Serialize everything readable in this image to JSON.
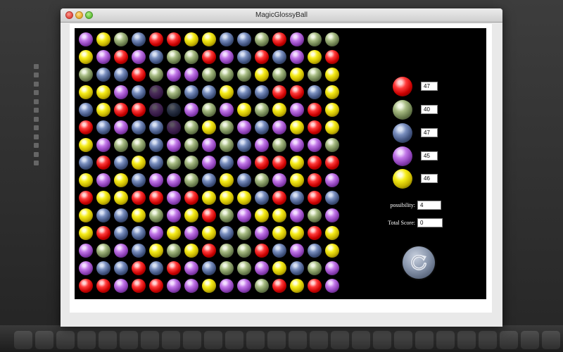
{
  "window": {
    "title": "MagicGlossyBall"
  },
  "board": {
    "rows": [
      [
        "purple",
        "yellow",
        "green",
        "blue",
        "red",
        "red",
        "yellow",
        "yellow",
        "blue",
        "blue",
        "green",
        "red",
        "purple",
        "green",
        "green"
      ],
      [
        "yellow",
        "purple",
        "red",
        "purple",
        "blue",
        "green",
        "green",
        "red",
        "purple",
        "blue",
        "red",
        "blue",
        "purple",
        "yellow",
        "red"
      ],
      [
        "green",
        "blue",
        "blue",
        "red",
        "green",
        "purple",
        "purple",
        "green",
        "green",
        "green",
        "yellow",
        "green",
        "yellow",
        "green",
        "yellow"
      ],
      [
        "yellow",
        "yellow",
        "purple",
        "blue",
        "purple",
        "green",
        "blue",
        "blue",
        "yellow",
        "blue",
        "blue",
        "red",
        "red",
        "blue",
        "yellow"
      ],
      [
        "blue",
        "yellow",
        "red",
        "red",
        "purple",
        "blue",
        "purple",
        "green",
        "purple",
        "yellow",
        "green",
        "yellow",
        "purple",
        "red",
        "yellow"
      ],
      [
        "red",
        "blue",
        "purple",
        "blue",
        "blue",
        "purple",
        "green",
        "yellow",
        "green",
        "purple",
        "blue",
        "purple",
        "yellow",
        "red",
        "yellow"
      ],
      [
        "yellow",
        "purple",
        "green",
        "green",
        "blue",
        "purple",
        "green",
        "purple",
        "green",
        "blue",
        "purple",
        "green",
        "purple",
        "purple",
        "green"
      ],
      [
        "blue",
        "red",
        "blue",
        "yellow",
        "blue",
        "green",
        "green",
        "purple",
        "blue",
        "purple",
        "red",
        "red",
        "yellow",
        "red",
        "red"
      ],
      [
        "yellow",
        "purple",
        "yellow",
        "blue",
        "purple",
        "purple",
        "green",
        "blue",
        "yellow",
        "blue",
        "green",
        "purple",
        "yellow",
        "red",
        "purple"
      ],
      [
        "red",
        "yellow",
        "yellow",
        "red",
        "red",
        "purple",
        "red",
        "yellow",
        "yellow",
        "yellow",
        "blue",
        "red",
        "blue",
        "red",
        "blue"
      ],
      [
        "yellow",
        "blue",
        "blue",
        "yellow",
        "green",
        "purple",
        "yellow",
        "red",
        "green",
        "purple",
        "yellow",
        "yellow",
        "purple",
        "green",
        "purple"
      ],
      [
        "yellow",
        "red",
        "blue",
        "blue",
        "purple",
        "yellow",
        "purple",
        "yellow",
        "blue",
        "green",
        "purple",
        "yellow",
        "yellow",
        "red",
        "yellow"
      ],
      [
        "purple",
        "green",
        "purple",
        "blue",
        "yellow",
        "green",
        "yellow",
        "red",
        "green",
        "green",
        "red",
        "blue",
        "purple",
        "blue",
        "yellow"
      ],
      [
        "purple",
        "blue",
        "blue",
        "red",
        "blue",
        "red",
        "purple",
        "blue",
        "green",
        "green",
        "purple",
        "yellow",
        "blue",
        "green",
        "purple"
      ],
      [
        "red",
        "red",
        "purple",
        "red",
        "red",
        "purple",
        "purple",
        "yellow",
        "purple",
        "purple",
        "green",
        "red",
        "yellow",
        "red",
        "purple"
      ]
    ],
    "selected": [
      [
        3,
        4
      ],
      [
        4,
        4
      ],
      [
        4,
        5
      ],
      [
        5,
        5
      ]
    ]
  },
  "color_counts": [
    {
      "color": "red",
      "icon": "red-ball-icon",
      "count": "47"
    },
    {
      "color": "green",
      "icon": "green-ball-icon",
      "count": "40"
    },
    {
      "color": "blue",
      "icon": "blue-ball-icon",
      "count": "47"
    },
    {
      "color": "purple",
      "icon": "purple-ball-icon",
      "count": "45"
    },
    {
      "color": "yellow",
      "icon": "yellow-ball-icon",
      "count": "46"
    }
  ],
  "stats": {
    "possibility_label": "possibility:",
    "possibility_value": "4",
    "total_score_label": "Total Score:",
    "total_score_value": "0"
  },
  "refresh_button": {
    "icon": "refresh-icon"
  },
  "colors": {
    "canvas_background": "#000000",
    "frame": "#ffffff"
  }
}
